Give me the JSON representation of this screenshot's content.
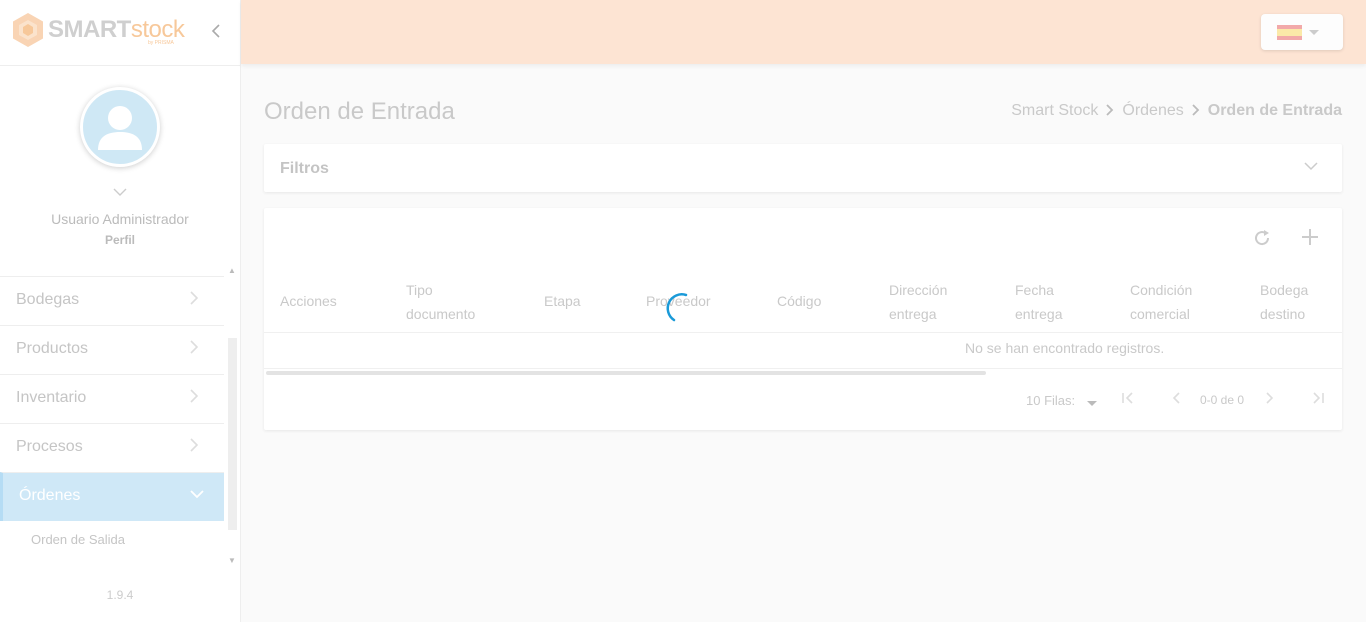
{
  "app": {
    "logo_smart": "SMART",
    "logo_stock": "stock",
    "logo_sub": "by PRISMA"
  },
  "profile": {
    "name": "Usuario Administrador",
    "role": "Perfil"
  },
  "sidebar": {
    "items": [
      {
        "label": "Bodegas",
        "icon": "chevron-right-icon"
      },
      {
        "label": "Productos",
        "icon": "chevron-right-icon"
      },
      {
        "label": "Inventario",
        "icon": "chevron-right-icon"
      },
      {
        "label": "Procesos",
        "icon": "chevron-right-icon"
      },
      {
        "label": "Órdenes",
        "icon": "chevron-down-icon",
        "active": true
      }
    ],
    "submenu": [
      {
        "label": "Orden de Salida"
      }
    ],
    "version": "1.9.4"
  },
  "header": {
    "language": "es",
    "flag_icon": "spain-flag-icon"
  },
  "main": {
    "title": "Orden de Entrada",
    "breadcrumb": [
      "Smart Stock",
      "Órdenes",
      "Orden de Entrada"
    ],
    "filters_label": "Filtros"
  },
  "table": {
    "columns": [
      {
        "line1": "Acciones",
        "line2": ""
      },
      {
        "line1": "Tipo",
        "line2": "documento"
      },
      {
        "line1": "Etapa",
        "line2": ""
      },
      {
        "line1": "Proveedor",
        "line2": ""
      },
      {
        "line1": "Código",
        "line2": ""
      },
      {
        "line1": "Dirección",
        "line2": "entrega"
      },
      {
        "line1": "Fecha",
        "line2": "entrega"
      },
      {
        "line1": "Condición",
        "line2": "comercial"
      },
      {
        "line1": "Bodega",
        "line2": "destino"
      }
    ],
    "empty_message": "No se han encontrado registros.",
    "rows_per_page": "10 Filas:",
    "range": "0-0 de 0"
  },
  "colors": {
    "header_bg": "#fde4d3",
    "active_menu_bg": "#cfe8f7",
    "spinner": "#1a9ad8",
    "logo_accent": "#f7c89a"
  }
}
